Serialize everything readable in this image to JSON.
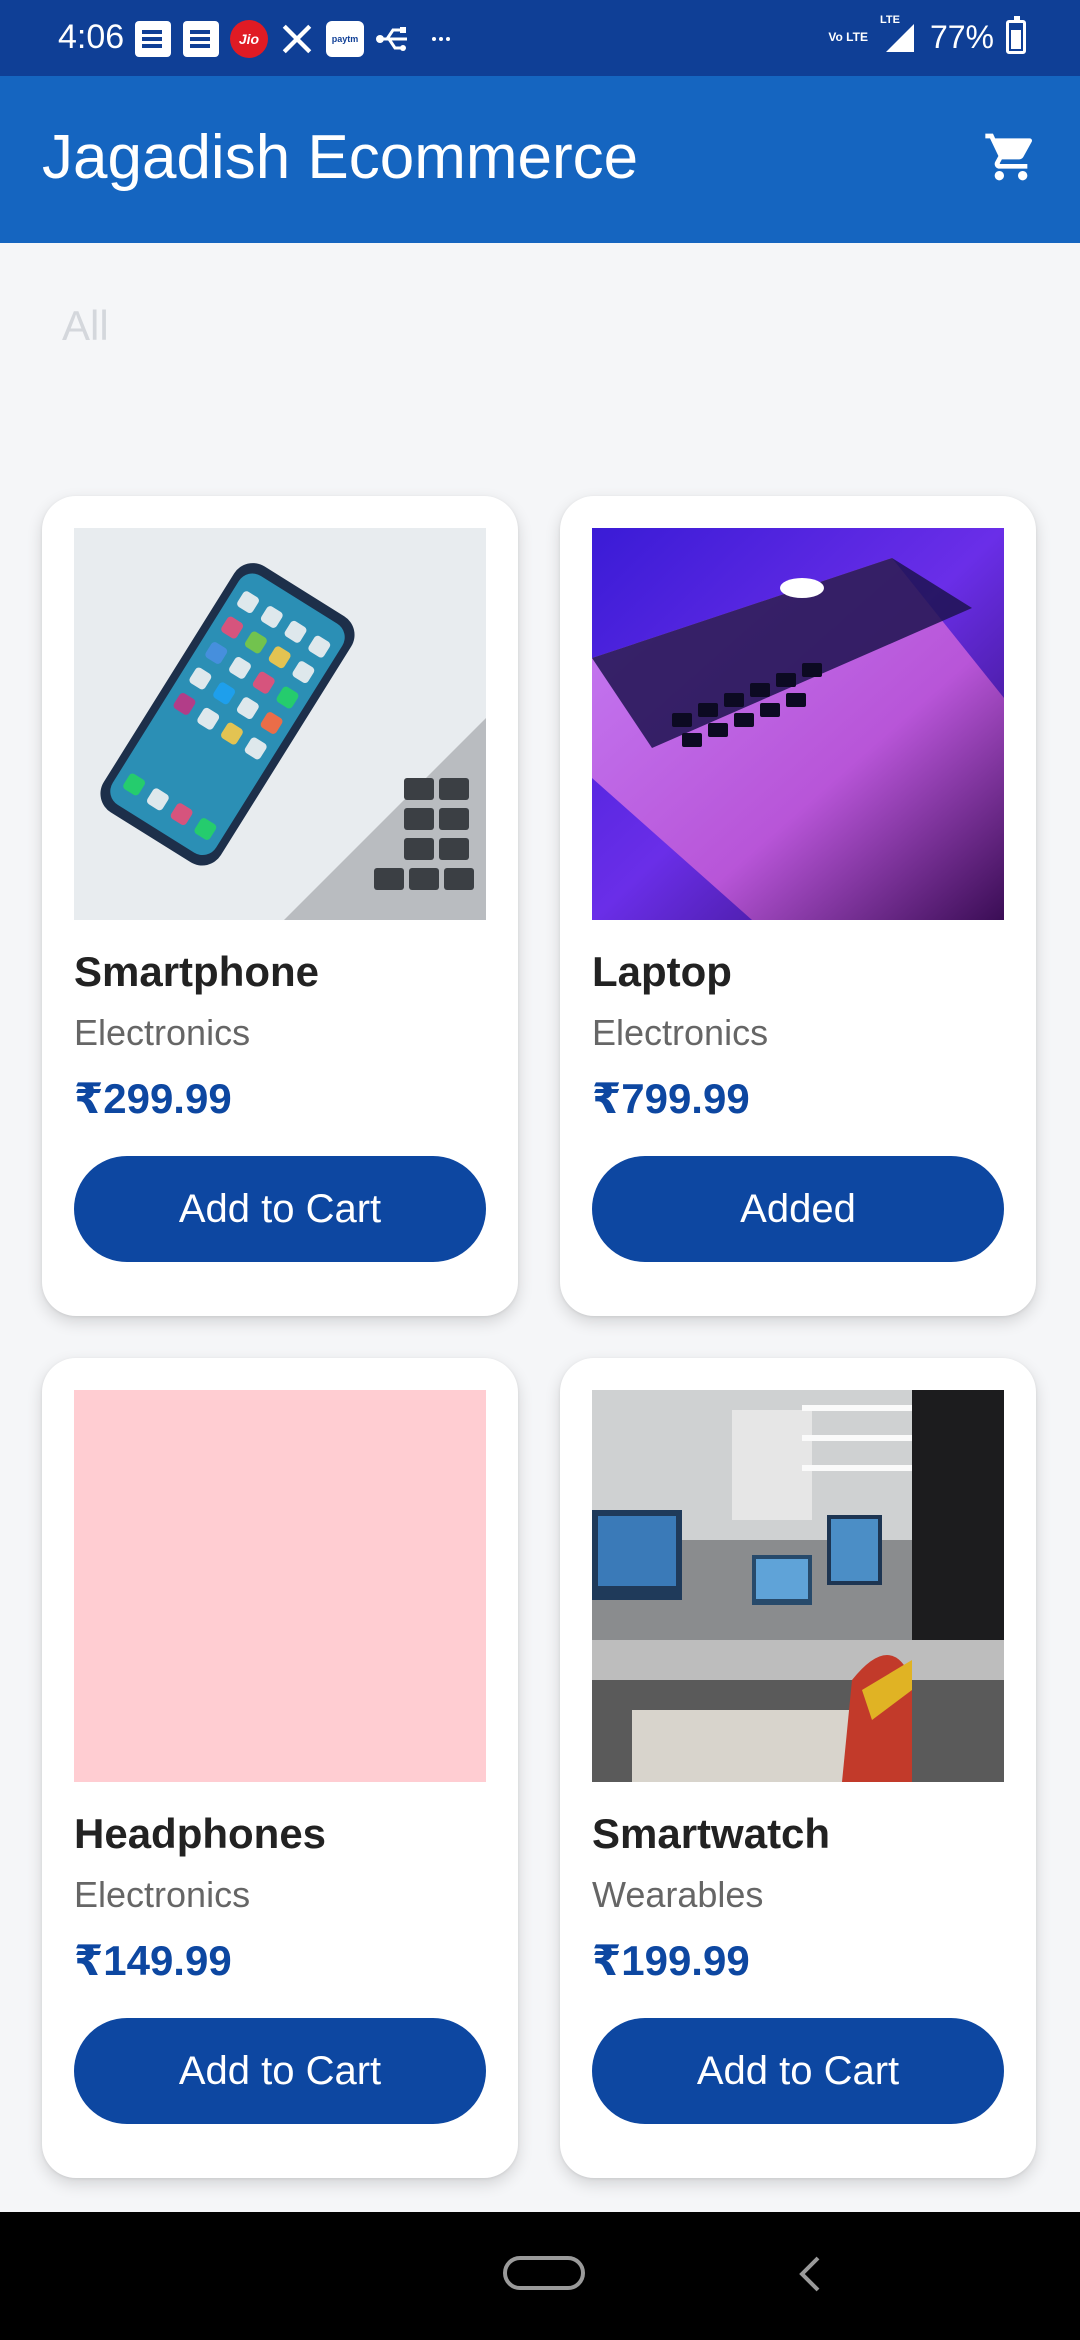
{
  "status_bar": {
    "time": "4:06",
    "volte": "Vo LTE",
    "battery": "77%",
    "icons": [
      "notes-icon",
      "notes-icon",
      "jio-icon",
      "x-icon",
      "paytm-icon",
      "usb-icon",
      "more-icon"
    ],
    "jio_label": "Jio",
    "paytm_label": "paytm",
    "network_label": "LTE"
  },
  "app_bar": {
    "title": "Jagadish Ecommerce",
    "cart_icon": "cart-icon"
  },
  "filter": {
    "selected": "All"
  },
  "products": [
    {
      "name": "Smartphone",
      "category": "Electronics",
      "price": "₹299.99",
      "button": "Add to Cart",
      "image": "smartphone-photo"
    },
    {
      "name": "Laptop",
      "category": "Electronics",
      "price": "₹799.99",
      "button": "Added",
      "image": "laptop-photo"
    },
    {
      "name": "Headphones",
      "category": "Electronics",
      "price": "₹149.99",
      "button": "Add to Cart",
      "image": "placeholder-pink"
    },
    {
      "name": "Smartwatch",
      "category": "Wearables",
      "price": "₹199.99",
      "button": "Add to Cart",
      "image": "office-photo"
    }
  ],
  "colors": {
    "status_bar": "#0f3f96",
    "app_bar": "#1565c0",
    "button": "#0d47a1",
    "price": "#0d47a1",
    "placeholder": "#ffcdd2"
  }
}
